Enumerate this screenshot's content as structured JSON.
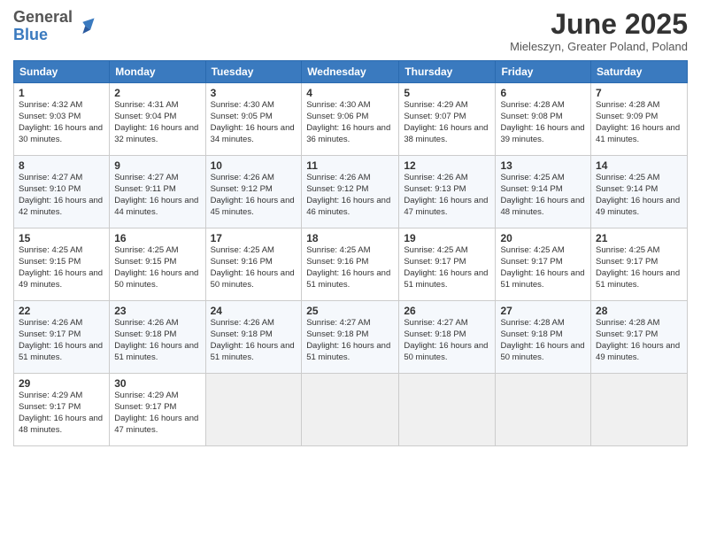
{
  "header": {
    "logo_general": "General",
    "logo_blue": "Blue",
    "month_title": "June 2025",
    "subtitle": "Mieleszyn, Greater Poland, Poland"
  },
  "weekdays": [
    "Sunday",
    "Monday",
    "Tuesday",
    "Wednesday",
    "Thursday",
    "Friday",
    "Saturday"
  ],
  "weeks": [
    [
      {
        "day": "1",
        "sunrise": "4:32 AM",
        "sunset": "9:03 PM",
        "daylight": "16 hours and 30 minutes."
      },
      {
        "day": "2",
        "sunrise": "4:31 AM",
        "sunset": "9:04 PM",
        "daylight": "16 hours and 32 minutes."
      },
      {
        "day": "3",
        "sunrise": "4:30 AM",
        "sunset": "9:05 PM",
        "daylight": "16 hours and 34 minutes."
      },
      {
        "day": "4",
        "sunrise": "4:30 AM",
        "sunset": "9:06 PM",
        "daylight": "16 hours and 36 minutes."
      },
      {
        "day": "5",
        "sunrise": "4:29 AM",
        "sunset": "9:07 PM",
        "daylight": "16 hours and 38 minutes."
      },
      {
        "day": "6",
        "sunrise": "4:28 AM",
        "sunset": "9:08 PM",
        "daylight": "16 hours and 39 minutes."
      },
      {
        "day": "7",
        "sunrise": "4:28 AM",
        "sunset": "9:09 PM",
        "daylight": "16 hours and 41 minutes."
      }
    ],
    [
      {
        "day": "8",
        "sunrise": "4:27 AM",
        "sunset": "9:10 PM",
        "daylight": "16 hours and 42 minutes."
      },
      {
        "day": "9",
        "sunrise": "4:27 AM",
        "sunset": "9:11 PM",
        "daylight": "16 hours and 44 minutes."
      },
      {
        "day": "10",
        "sunrise": "4:26 AM",
        "sunset": "9:12 PM",
        "daylight": "16 hours and 45 minutes."
      },
      {
        "day": "11",
        "sunrise": "4:26 AM",
        "sunset": "9:12 PM",
        "daylight": "16 hours and 46 minutes."
      },
      {
        "day": "12",
        "sunrise": "4:26 AM",
        "sunset": "9:13 PM",
        "daylight": "16 hours and 47 minutes."
      },
      {
        "day": "13",
        "sunrise": "4:25 AM",
        "sunset": "9:14 PM",
        "daylight": "16 hours and 48 minutes."
      },
      {
        "day": "14",
        "sunrise": "4:25 AM",
        "sunset": "9:14 PM",
        "daylight": "16 hours and 49 minutes."
      }
    ],
    [
      {
        "day": "15",
        "sunrise": "4:25 AM",
        "sunset": "9:15 PM",
        "daylight": "16 hours and 49 minutes."
      },
      {
        "day": "16",
        "sunrise": "4:25 AM",
        "sunset": "9:15 PM",
        "daylight": "16 hours and 50 minutes."
      },
      {
        "day": "17",
        "sunrise": "4:25 AM",
        "sunset": "9:16 PM",
        "daylight": "16 hours and 50 minutes."
      },
      {
        "day": "18",
        "sunrise": "4:25 AM",
        "sunset": "9:16 PM",
        "daylight": "16 hours and 51 minutes."
      },
      {
        "day": "19",
        "sunrise": "4:25 AM",
        "sunset": "9:17 PM",
        "daylight": "16 hours and 51 minutes."
      },
      {
        "day": "20",
        "sunrise": "4:25 AM",
        "sunset": "9:17 PM",
        "daylight": "16 hours and 51 minutes."
      },
      {
        "day": "21",
        "sunrise": "4:25 AM",
        "sunset": "9:17 PM",
        "daylight": "16 hours and 51 minutes."
      }
    ],
    [
      {
        "day": "22",
        "sunrise": "4:26 AM",
        "sunset": "9:17 PM",
        "daylight": "16 hours and 51 minutes."
      },
      {
        "day": "23",
        "sunrise": "4:26 AM",
        "sunset": "9:18 PM",
        "daylight": "16 hours and 51 minutes."
      },
      {
        "day": "24",
        "sunrise": "4:26 AM",
        "sunset": "9:18 PM",
        "daylight": "16 hours and 51 minutes."
      },
      {
        "day": "25",
        "sunrise": "4:27 AM",
        "sunset": "9:18 PM",
        "daylight": "16 hours and 51 minutes."
      },
      {
        "day": "26",
        "sunrise": "4:27 AM",
        "sunset": "9:18 PM",
        "daylight": "16 hours and 50 minutes."
      },
      {
        "day": "27",
        "sunrise": "4:28 AM",
        "sunset": "9:18 PM",
        "daylight": "16 hours and 50 minutes."
      },
      {
        "day": "28",
        "sunrise": "4:28 AM",
        "sunset": "9:17 PM",
        "daylight": "16 hours and 49 minutes."
      }
    ],
    [
      {
        "day": "29",
        "sunrise": "4:29 AM",
        "sunset": "9:17 PM",
        "daylight": "16 hours and 48 minutes."
      },
      {
        "day": "30",
        "sunrise": "4:29 AM",
        "sunset": "9:17 PM",
        "daylight": "16 hours and 47 minutes."
      },
      null,
      null,
      null,
      null,
      null
    ]
  ]
}
